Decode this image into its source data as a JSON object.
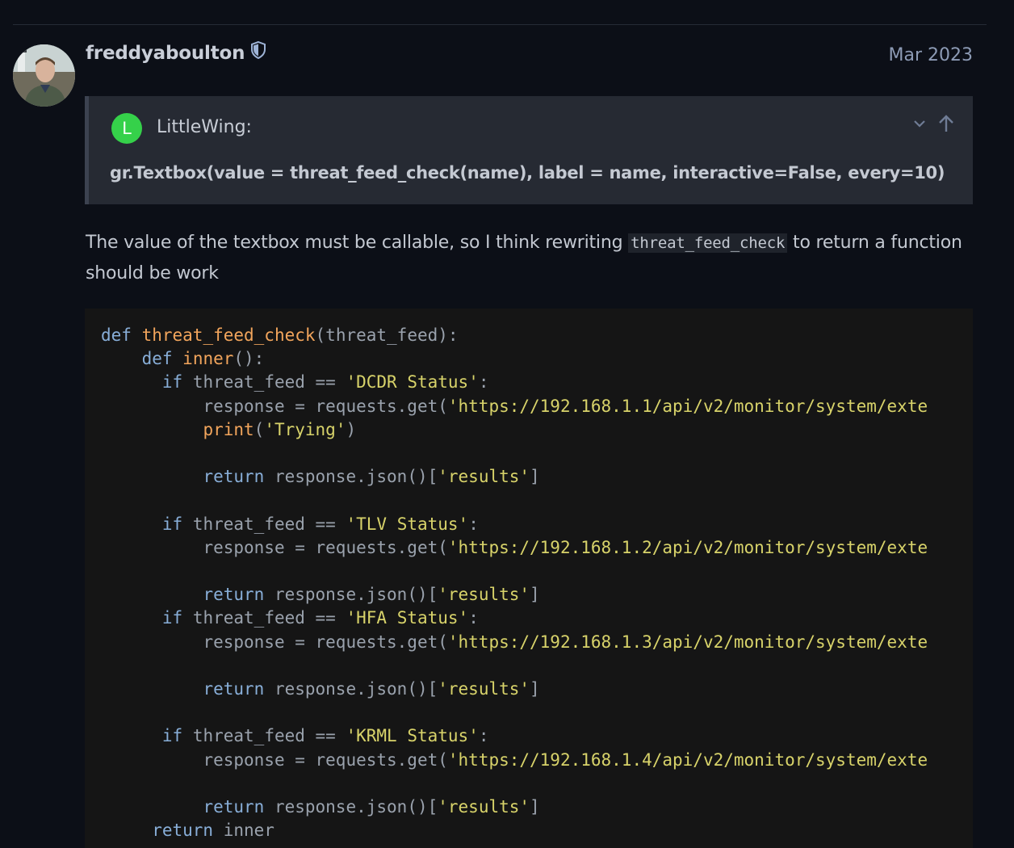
{
  "post": {
    "username": "freddyaboulton",
    "date": "Mar 2023",
    "badge_icon": "shield-icon"
  },
  "quote": {
    "avatar_letter": "L",
    "avatar_color": "#35d14a",
    "username": "LittleWing:",
    "text": "gr.Textbox(value = threat_feed_check(name), label = name, interactive=False, every=10)"
  },
  "body": {
    "text_before": "The value of the textbox must be callable, so I think rewriting ",
    "inline_code": "threat_feed_check",
    "text_after": " to return a function should be work"
  },
  "code": {
    "def": "def",
    "if": "if",
    "return": "return",
    "print": "print",
    "fn_outer": "threat_feed_check",
    "param_outer": "(threat_feed):",
    "fn_inner": "inner",
    "paren_inner": "():",
    "cond_prefix": "threat_feed ==",
    "colon": ":",
    "status_1": "'DCDR Status'",
    "status_2": "'TLV Status'",
    "status_3": "'HFA Status'",
    "status_4": "'KRML Status'",
    "get_prefix": "response = requests.get(",
    "url_1": "'https://192.168.1.1/api/v2/monitor/system/exte",
    "url_2": "'https://192.168.1.2/api/v2/monitor/system/exte",
    "url_3": "'https://192.168.1.3/api/v2/monitor/system/exte",
    "url_4": "'https://192.168.1.4/api/v2/monitor/system/exte",
    "print_open": "(",
    "print_arg": "'Trying'",
    "print_close": ")",
    "json_prefix": "response.json()[",
    "results_key": "'results'",
    "bracket_close": "]",
    "inner_ref": "inner"
  }
}
